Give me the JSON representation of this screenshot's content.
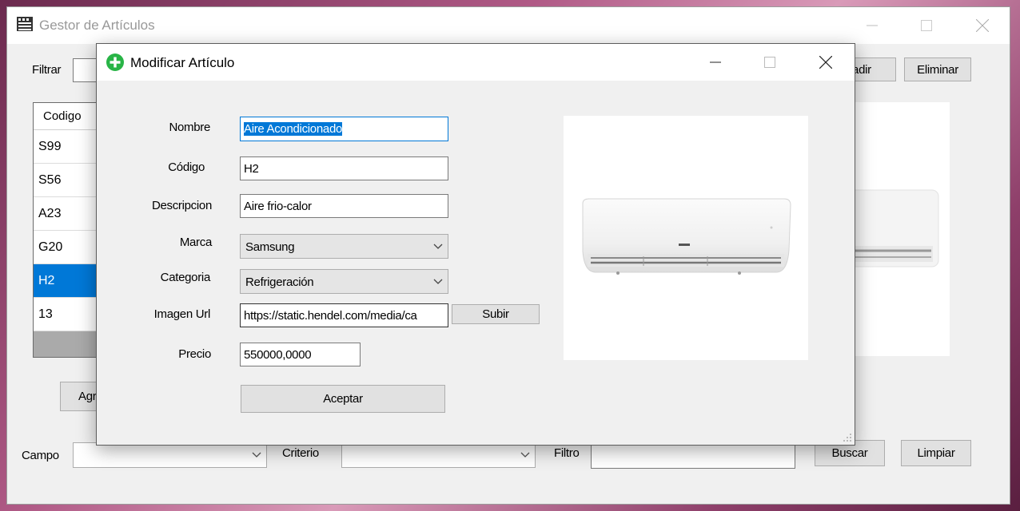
{
  "main_window": {
    "title": "Gestor de Artículos",
    "filter_label": "Filtrar",
    "filter_value": "",
    "add_button_partial": "ñadir",
    "delete_button": "Eliminar",
    "grid": {
      "column_header": "Codigo",
      "rows": [
        "S99",
        "S56",
        "A23",
        "G20",
        "H2",
        "13"
      ],
      "selected_index": 4
    },
    "bottom_add_button_partial": "Agr",
    "campo_label": "Campo",
    "criterio_label": "Criterio",
    "filtro_label": "Filtro",
    "buscar_button": "Buscar",
    "limpiar_button": "Limpiar"
  },
  "dialog": {
    "title": "Modificar Artículo",
    "fields": {
      "nombre_label": "Nombre",
      "nombre_value": "Aire Acondicionado",
      "codigo_label": "Código",
      "codigo_value": "H2",
      "descripcion_label": "Descripcion",
      "descripcion_value": "Aire frio-calor",
      "marca_label": "Marca",
      "marca_value": "Samsung",
      "categoria_label": "Categoria",
      "categoria_value": "Refrigeración",
      "imagen_label": "Imagen Url",
      "imagen_value": "https://static.hendel.com/media/ca",
      "precio_label": "Precio",
      "precio_value": "550000,0000"
    },
    "upload_button": "Subir",
    "accept_button": "Aceptar",
    "accent_color": "#0078d7",
    "icon_color": "#28b446"
  }
}
